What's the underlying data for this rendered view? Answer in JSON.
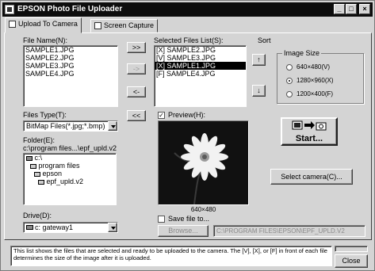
{
  "window": {
    "title": "EPSON Photo File Uploader"
  },
  "titlebar_buttons": {
    "minimize": "_",
    "maximize": "□",
    "close": "×"
  },
  "tabs": [
    {
      "label": "Upload To Camera",
      "active": true
    },
    {
      "label": "Screen Capture",
      "active": false
    }
  ],
  "file_name": {
    "label": "File Name(N):",
    "items": [
      "SAMPLE1.JPG",
      "SAMPLE2.JPG",
      "SAMPLE3.JPG",
      "SAMPLE4.JPG"
    ]
  },
  "transfer_buttons": {
    "add_all": ">>",
    "add": "->",
    "remove": "<-",
    "remove_all": "<<"
  },
  "selected_files": {
    "label": "Selected Files List(S):",
    "items": [
      "[X] SAMPLE2.JPG",
      "[V] SAMPLE3.JPG",
      "[X] SAMPLE1.JPG",
      "[F] SAMPLE4.JPG"
    ],
    "selected_index": 2
  },
  "sort": {
    "label": "Sort",
    "up": "↑",
    "down": "↓"
  },
  "image_size": {
    "label": "Image Size",
    "options": [
      "640×480(V)",
      "1280×960(X)",
      "1200×400(F)"
    ],
    "selected_index": 1
  },
  "start_button": {
    "label": "Start..."
  },
  "files_type": {
    "label": "Files Type(T):",
    "value": "BitMap Files(*.jpg;*.bmp)"
  },
  "folder": {
    "label": "Folder(E):",
    "path": "c:\\program files...\\epf_upld.v2",
    "tree": [
      "c:\\",
      "program files",
      "epson",
      "epf_upld.v2"
    ]
  },
  "drive": {
    "label": "Drive(D):",
    "value": "c: gateway1"
  },
  "preview": {
    "label": "Preview(H):",
    "checked": true,
    "dimensions": "640×480"
  },
  "select_camera_button": {
    "label": "Select camera(C)..."
  },
  "save_file": {
    "label": "Save file to...",
    "checked": false
  },
  "browse_button": {
    "label": "Browse..."
  },
  "save_path": {
    "value": "C:\\PROGRAM FILES\\EPSON\\EPF_UPLD.V2"
  },
  "status": {
    "text": "This list shows the files that are selected and ready to be uploaded to the camera. The [V], [X], or [F] in front of each file determines the size of the image after it is uploaded."
  },
  "close_button": {
    "label": "Close"
  }
}
